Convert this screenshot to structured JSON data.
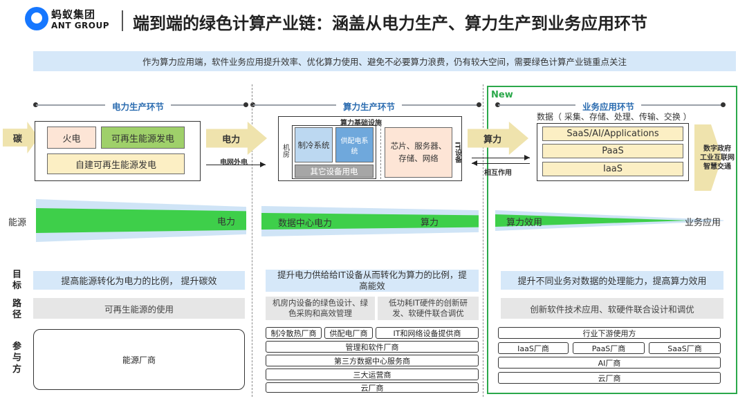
{
  "header": {
    "logo_cn": "蚂蚁集团",
    "logo_en": "ANT GROUP",
    "title": "端到端的绿色计算产业链：涵盖从电力生产、算力生产到业务应用环节",
    "subtitle": "作为算力应用端，软件业务应用提升效率、优化算力使用、避免不必要算力浪费，仍有较大空间，需要绿色计算产业链重点关注"
  },
  "new_label": "New",
  "sections": {
    "power": "电力生产环节",
    "compute": "算力生产环节",
    "app": "业务应用环节"
  },
  "flow": {
    "carbon": "碳",
    "power_box": {
      "thermal": "火电",
      "renewable": "可再生能源发电",
      "self_built": "自建可再生能源发电"
    },
    "power_arrow": "电力",
    "grid_label": "电网外电",
    "compute_box": {
      "infra_label": "算力基础设施",
      "room_label": "机房",
      "cooling": "制冷系统",
      "power_supply": "供配电系统",
      "other": "其它设备用电",
      "chips": "芯片、服务器、存储、网络",
      "it_label": "IT设备"
    },
    "compute_arrow": "算力",
    "interact_label": "相互作用",
    "app_box": {
      "data_label": "数据（ 采集、存储、处理、传输、交换 ）",
      "saas": "SaaS/AI/Applications",
      "paas": "PaaS",
      "iaas": "IaaS"
    },
    "outputs": [
      "数字政府",
      "工业互联网",
      "智慧交通"
    ]
  },
  "energy": {
    "row_label": "能源",
    "power": "电力",
    "dc_power": "数据中心电力",
    "compute": "算力",
    "efficiency": "算力效用",
    "business": "业务应用"
  },
  "rows": {
    "goal_label": "目标",
    "path_label": "路径",
    "party_label": "参与方"
  },
  "goals": {
    "power": "提高能源转化为电力的比例， 提升碳效",
    "compute": "提升电力供给给IT设备从而转化为算力的比例，提高能效",
    "app": "提升不同业务对数据的处理能力，提高算力效用"
  },
  "paths": {
    "power": "可再生能源的使用",
    "compute_a": "机房内设备的绿色设计、绿色采购和高效管理",
    "compute_b": "低功耗IT硬件的创新研发、软硬件联合调优",
    "app": "创新软件技术应用、软硬件联合设计和调优"
  },
  "parties": {
    "power": "能源厂商",
    "compute_row1": [
      "制冷散热厂商",
      "供配电厂商",
      "IT和网络设备提供商"
    ],
    "compute_rest": [
      "管理和软件厂商",
      "第三方数据中心服务商",
      "三大运营商",
      "云厂商"
    ],
    "app_top": "行业下游使用方",
    "app_row": [
      "IaaS厂商",
      "PaaS厂商",
      "SaaS厂商"
    ],
    "app_rest": [
      "AI厂商",
      "云厂商"
    ]
  },
  "colors": {
    "accent_blue": "#2b6cb0",
    "light_blue": "#d6e8f9",
    "green": "#3ecf4a",
    "new_green": "#2aa84a",
    "arrow_yellow": "#efe3ad"
  }
}
